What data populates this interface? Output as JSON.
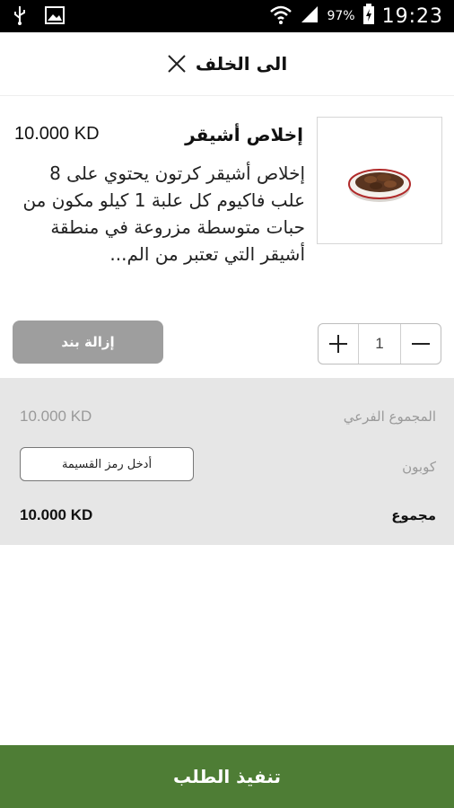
{
  "status_bar": {
    "battery_percent": "97%",
    "time": "19:23",
    "icons": [
      "usb-icon",
      "image-icon",
      "wifi-icon",
      "signal-icon",
      "battery-icon"
    ]
  },
  "header": {
    "back_label": "الى الخلف",
    "close_icon": "close-icon"
  },
  "cart_item": {
    "name": "إخلاص أشيقر",
    "price": "10.000 KD",
    "description": "إخلاص أشيقر كرتون يحتوي على 8 علب فاكيوم كل علبة 1 كيلو مكون من حبات متوسطة مزروعة في منطقة أشيقر التي تعتبر من الم...",
    "image_icon": "dates-bowl-image",
    "quantity": "1",
    "remove_label": "إزالة بند"
  },
  "summary": {
    "subtotal_label": "المجموع الفرعي",
    "subtotal_value": "10.000 KD",
    "coupon_label": "كوبون",
    "coupon_placeholder": "أدخل رمز القسيمة",
    "total_label": "مجموع",
    "total_value": "10.000 KD"
  },
  "checkout": {
    "label": "تنفيذ الطلب"
  },
  "colors": {
    "checkout_green": "#4e7d35",
    "summary_bg": "#e6e6e6",
    "remove_button_gray": "#9e9e9e"
  }
}
